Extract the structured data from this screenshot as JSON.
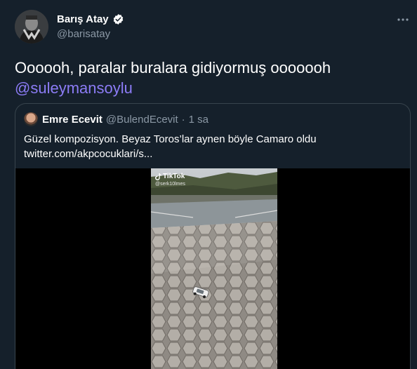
{
  "author": {
    "display_name": "Barış Atay",
    "handle": "@barisatay",
    "verified": true
  },
  "tweet": {
    "text": "Oooooh, paralar buralara gidiyormuş ooooooh",
    "mention": "@suleymansoylu"
  },
  "quoted": {
    "display_name": "Emre Ecevit",
    "handle": "@BulendEcevit",
    "separator": "·",
    "time": "1 sa",
    "text_line1": "Güzel kompozisyon. Beyaz Toros’lar aynen böyle Camaro oldu",
    "text_line2": "twitter.com/akpcocuklari/s...",
    "media": {
      "watermark": "TikTok",
      "watermark_user": "@serk10lmes"
    }
  },
  "icons": {
    "more": "more-horizontal-icon",
    "verified": "verified-badge-icon",
    "tiktok": "tiktok-logo-icon"
  },
  "colors": {
    "background": "#15202b",
    "text": "#ffffff",
    "secondary_text": "#8b98a5",
    "mention": "#8c7cf6",
    "border": "#38444d",
    "verified": "#ffffff"
  }
}
